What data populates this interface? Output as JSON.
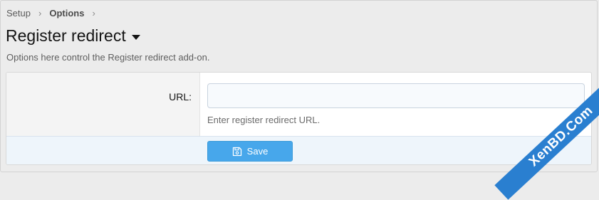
{
  "breadcrumb": {
    "items": [
      "Setup",
      "Options"
    ],
    "separator": "›"
  },
  "page": {
    "title": "Register redirect",
    "description": "Options here control the Register redirect add-on."
  },
  "form": {
    "url_label": "URL:",
    "url_value": "",
    "url_placeholder": "",
    "url_hint": "Enter register redirect URL.",
    "save_label": "Save"
  },
  "icons": {
    "title_menu": "caret-down-icon",
    "save": "floppy-disk-icon"
  },
  "watermark": {
    "text": "XenBD.Com"
  },
  "colors": {
    "accent": "#47a7eb",
    "submit_row": "#eef5fb",
    "watermark": "#2a7fd0"
  }
}
